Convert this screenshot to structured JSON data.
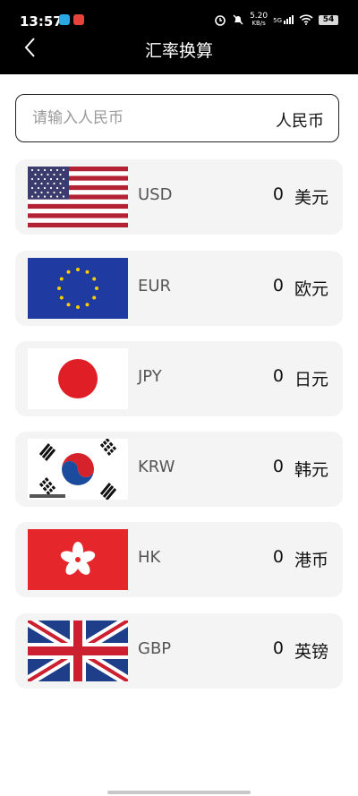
{
  "status": {
    "time": "13:57",
    "speed_top": "5.20",
    "speed_unit": "KB/s",
    "network": "5G",
    "battery": "54"
  },
  "header": {
    "title": "汇率换算"
  },
  "input": {
    "placeholder": "请输入人民币",
    "base_currency": "人民币"
  },
  "currencies": [
    {
      "code": "USD",
      "amount": "0",
      "name": "美元",
      "flag_icon": "us-flag-icon"
    },
    {
      "code": "EUR",
      "amount": "0",
      "name": "欧元",
      "flag_icon": "eu-flag-icon"
    },
    {
      "code": "JPY",
      "amount": "0",
      "name": "日元",
      "flag_icon": "jp-flag-icon"
    },
    {
      "code": "KRW",
      "amount": "0",
      "name": "韩元",
      "flag_icon": "kr-flag-icon"
    },
    {
      "code": "HK",
      "amount": "0",
      "name": "港币",
      "flag_icon": "hk-flag-icon"
    },
    {
      "code": "GBP",
      "amount": "0",
      "name": "英镑",
      "flag_icon": "gb-flag-icon"
    }
  ],
  "colors": {
    "header_bg": "#000000",
    "card_bg": "#f4f4f4"
  }
}
